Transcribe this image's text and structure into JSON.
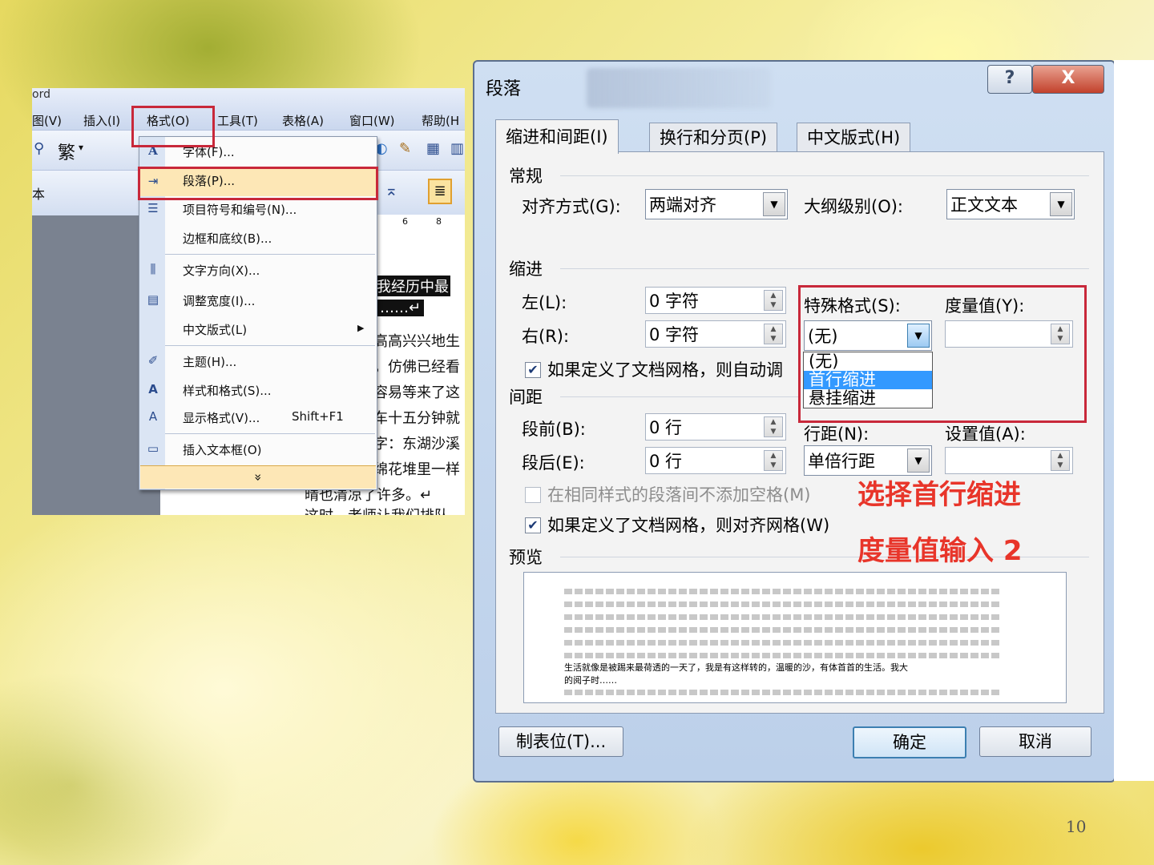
{
  "word": {
    "title_fragment": "ord",
    "menu": {
      "view": "图(V)",
      "insert": "插入(I)",
      "format": "格式(O)",
      "tools": "工具(T)",
      "table": "表格(A)",
      "window": "窗口(W)",
      "help": "帮助(H"
    },
    "toolbar": {
      "trad": "繁",
      "font_fragment": "本",
      "ruler_6": "6",
      "ruler_8": "8"
    },
    "format_menu": [
      {
        "label": "字体(F)...",
        "icon": "font-A-icon"
      },
      {
        "label": "段落(P)...",
        "icon": "paragraph-icon"
      },
      {
        "label": "项目符号和编号(N)...",
        "icon": "bullets-icon"
      },
      {
        "label": "边框和底纹(B)...",
        "icon": ""
      },
      {
        "label": "文字方向(X)...",
        "icon": "text-direction-icon"
      },
      {
        "label": "调整宽度(I)...",
        "icon": "adjust-width-icon"
      },
      {
        "label": "中文版式(L)",
        "icon": "",
        "arrow": "▶"
      },
      {
        "label": "主题(H)...",
        "icon": "theme-icon"
      },
      {
        "label": "样式和格式(S)...",
        "icon": "styles-icon"
      },
      {
        "label": "显示格式(V)...",
        "icon": "reveal-format-icon",
        "shortcut": "Shift+F1"
      },
      {
        "label": "插入文本框(O)",
        "icon": "textbox-icon"
      }
    ],
    "expand_glyph": "»",
    "doc_lines": [
      "是我经历中最",
      "……↵",
      "高高兴兴地生",
      "，仿佛已经看",
      "容易等来了这",
      "车十五分钟就",
      "字：东湖沙溪",
      "绵花堆里一样",
      "晴也清凉了许多。↵",
      "这时，老师让我们排队"
    ]
  },
  "dialog": {
    "title": "段落",
    "help_btn": "?",
    "close_btn": "X",
    "tabs": [
      "缩进和间距(I)",
      "换行和分页(P)",
      "中文版式(H)"
    ],
    "general": {
      "section": "常规",
      "align_label": "对齐方式(G):",
      "align_value": "两端对齐",
      "outline_label": "大纲级别(O):",
      "outline_value": "正文文本"
    },
    "indent": {
      "section": "缩进",
      "left_label": "左(L):",
      "left_value": "0 字符",
      "right_label": "右(R):",
      "right_value": "0 字符",
      "special_label": "特殊格式(S):",
      "special_value": "(无)",
      "measure_label": "度量值(Y):",
      "measure_value": "",
      "auto_grid_label": "如果定义了文档网格，则自动调",
      "auto_grid_checked": true,
      "options": [
        "(无)",
        "首行缩进",
        "悬挂缩进"
      ]
    },
    "spacing": {
      "section": "间距",
      "before_label": "段前(B):",
      "before_value": "0 行",
      "after_label": "段后(E):",
      "after_value": "0 行",
      "line_label": "行距(N):",
      "line_value": "单倍行距",
      "at_label": "设置值(A):",
      "at_value": "",
      "no_space_label": "在相同样式的段落间不添加空格(M)",
      "no_space_checked": false,
      "snap_label": "如果定义了文档网格，则对齐网格(W)",
      "snap_checked": true
    },
    "preview": {
      "section": "预览",
      "sample_line1": "生活就像是被踢来最荷透的一天了，我是有这样转的，温暖的沙，有体首首的生活。我大",
      "sample_line2": "的阅子时……"
    },
    "buttons": {
      "tabs": "制表位(T)...",
      "ok": "确定",
      "cancel": "取消"
    }
  },
  "annotations": {
    "line1": "选择首行缩进",
    "line2": "度量值输入 2"
  },
  "slide_number": "10",
  "colors": {
    "highlight_red": "#c8283a",
    "annotation_red": "#e8352a",
    "selection_blue": "#3399ff"
  }
}
